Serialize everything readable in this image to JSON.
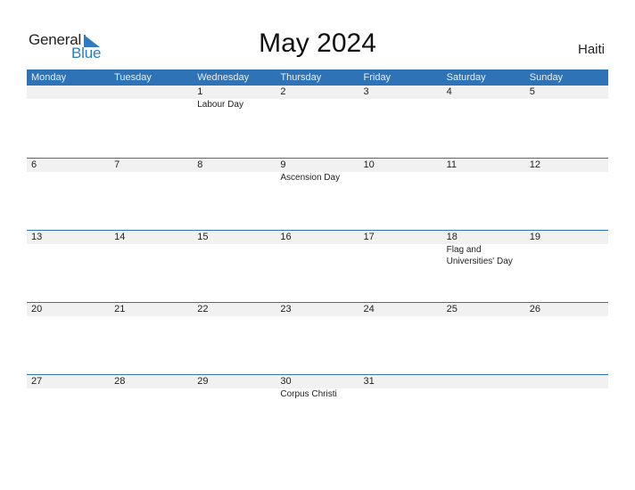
{
  "logo": {
    "general": "General",
    "blue": "Blue"
  },
  "title": "May 2024",
  "country": "Haiti",
  "colors": {
    "header_bg": "#2e73b6",
    "day_row_bg": "#f1f1f1",
    "brand_blue": "#2f7bbf"
  },
  "weekdays": [
    "Monday",
    "Tuesday",
    "Wednesday",
    "Thursday",
    "Friday",
    "Saturday",
    "Sunday"
  ],
  "weeks": [
    {
      "days": [
        "",
        "",
        "1",
        "2",
        "3",
        "4",
        "5"
      ],
      "events": [
        "",
        "",
        "Labour Day",
        "",
        "",
        "",
        ""
      ]
    },
    {
      "days": [
        "6",
        "7",
        "8",
        "9",
        "10",
        "11",
        "12"
      ],
      "events": [
        "",
        "",
        "",
        "Ascension Day",
        "",
        "",
        ""
      ]
    },
    {
      "days": [
        "13",
        "14",
        "15",
        "16",
        "17",
        "18",
        "19"
      ],
      "events": [
        "",
        "",
        "",
        "",
        "",
        "Flag and Universities' Day",
        ""
      ]
    },
    {
      "days": [
        "20",
        "21",
        "22",
        "23",
        "24",
        "25",
        "26"
      ],
      "events": [
        "",
        "",
        "",
        "",
        "",
        "",
        ""
      ]
    },
    {
      "days": [
        "27",
        "28",
        "29",
        "30",
        "31",
        "",
        ""
      ],
      "events": [
        "",
        "",
        "",
        "Corpus Christi",
        "",
        "",
        ""
      ]
    }
  ]
}
